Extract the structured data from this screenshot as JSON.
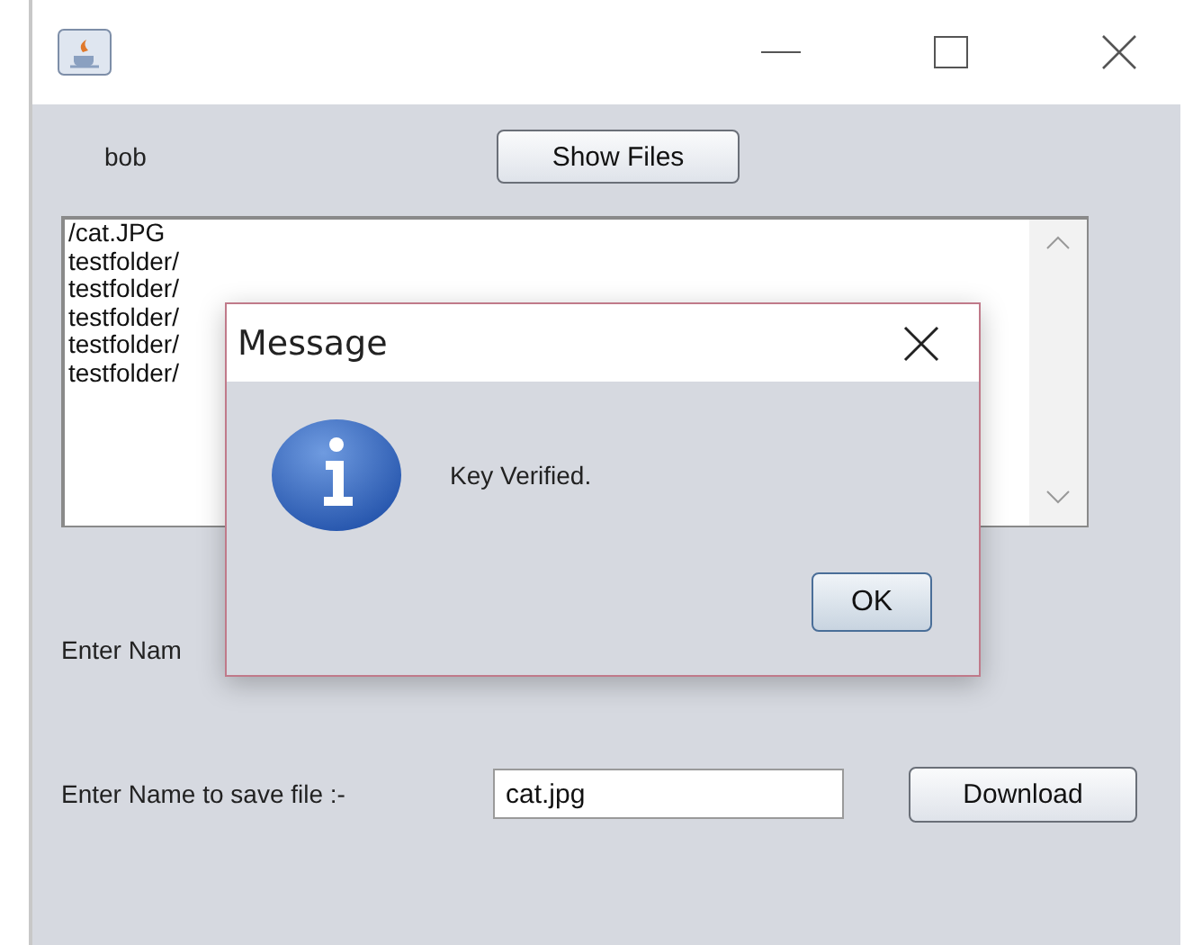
{
  "window": {
    "user_label": "bob",
    "show_files_button": "Show Files",
    "file_list": [
      "/cat.JPG",
      "testfolder/",
      "testfolder/",
      "testfolder/",
      "testfolder/",
      "testfolder/"
    ],
    "name_label": "Enter Nam",
    "save_label": "Enter Name to save file :-",
    "save_field": {
      "value": "cat.jpg"
    },
    "download_button": "Download"
  },
  "dialog": {
    "title": "Message",
    "message": "Key Verified.",
    "button": "OK"
  }
}
